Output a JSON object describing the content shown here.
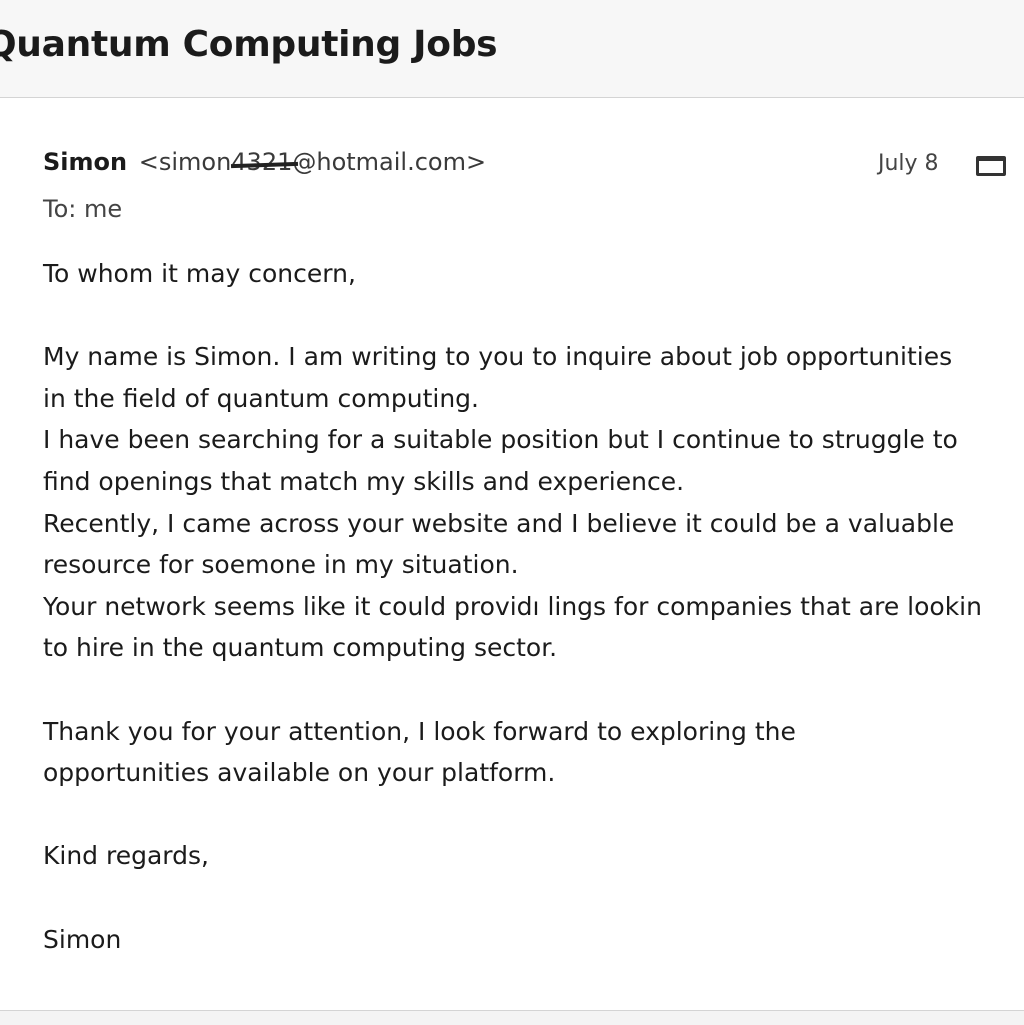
{
  "email": {
    "subject": "Quantum Computing Jobs",
    "sender_name": "Simon",
    "sender_email_open": " <simon",
    "sender_email_redacted": "4321",
    "sender_email_rest": "@hotmail.com>",
    "date": "July 8",
    "to": "To: me",
    "body_lines": [
      "To whom it may concern,",
      "",
      "My name is Simon. I am writing to you to inquire about job opportunities",
      "in the field of quantum computing.",
      "I have been searching for a suitable position but I continue to struggle to",
      "find openings that match my skills and experience.",
      "Recently, I came across your website and I believe it could be a valuable",
      "resource for soemone in my situation.",
      "Your network seems like it could providı lings for companies that are lookin",
      "to hire in the quantum computing sector.",
      "",
      "Thank you for your attention, I look forward to exploring the",
      "opportunities available on your platform.",
      "",
      "Kind regards,",
      "",
      "Simon"
    ]
  },
  "icons": {
    "window": "window-icon"
  }
}
